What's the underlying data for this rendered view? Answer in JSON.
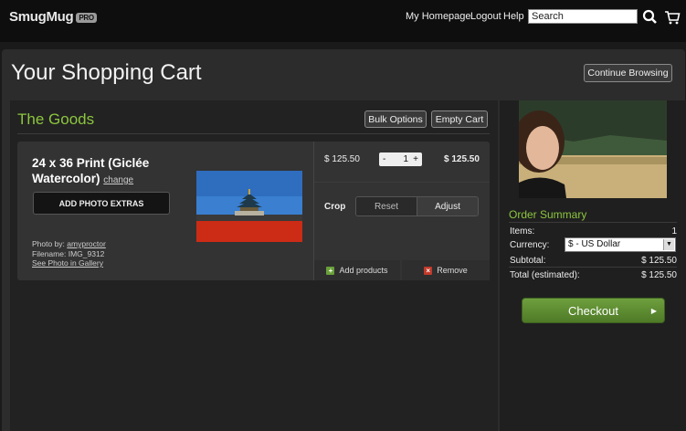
{
  "brand": {
    "name": "SmugMug",
    "badge": "PRO"
  },
  "nav": {
    "home": "My Homepage",
    "logout": "Logout",
    "help": "Help",
    "search_value": "Search"
  },
  "icons": {
    "search": "search-icon",
    "cart": "cart-icon"
  },
  "page_title": "Your Shopping Cart",
  "continue_label": "Continue Browsing",
  "goods": {
    "title": "The Goods",
    "bulk_label": "Bulk Options",
    "empty_label": "Empty Cart"
  },
  "item": {
    "title": "24 x 36 Print (Giclée Watercolor)",
    "change_label": "change",
    "extras_label": "ADD PHOTO EXTRAS",
    "photo_by_label": "Photo by:",
    "photo_by_user": "amyproctor",
    "filename_label": "Filename:",
    "filename": "IMG_9312",
    "gallery_link": "See Photo in Gallery",
    "unit_price": "$ 125.50",
    "qty_minus": "-",
    "qty_value": "1",
    "qty_plus": "+",
    "line_total": "$ 125.50",
    "crop_label": "Crop",
    "reset_label": "Reset",
    "adjust_label": "Adjust",
    "add_products_label": "Add products",
    "remove_label": "Remove"
  },
  "summary": {
    "title": "Order Summary",
    "items_label": "Items:",
    "items_value": "1",
    "currency_label": "Currency:",
    "currency_value": "$ - US Dollar",
    "subtotal_label": "Subtotal:",
    "subtotal_value": "$ 125.50",
    "total_label": "Total (estimated):",
    "total_value": "$ 125.50",
    "checkout_label": "Checkout"
  },
  "colors": {
    "accent_green": "#8cc63e",
    "checkout_green": "#5e8e32",
    "background": "#2c2c2c"
  }
}
